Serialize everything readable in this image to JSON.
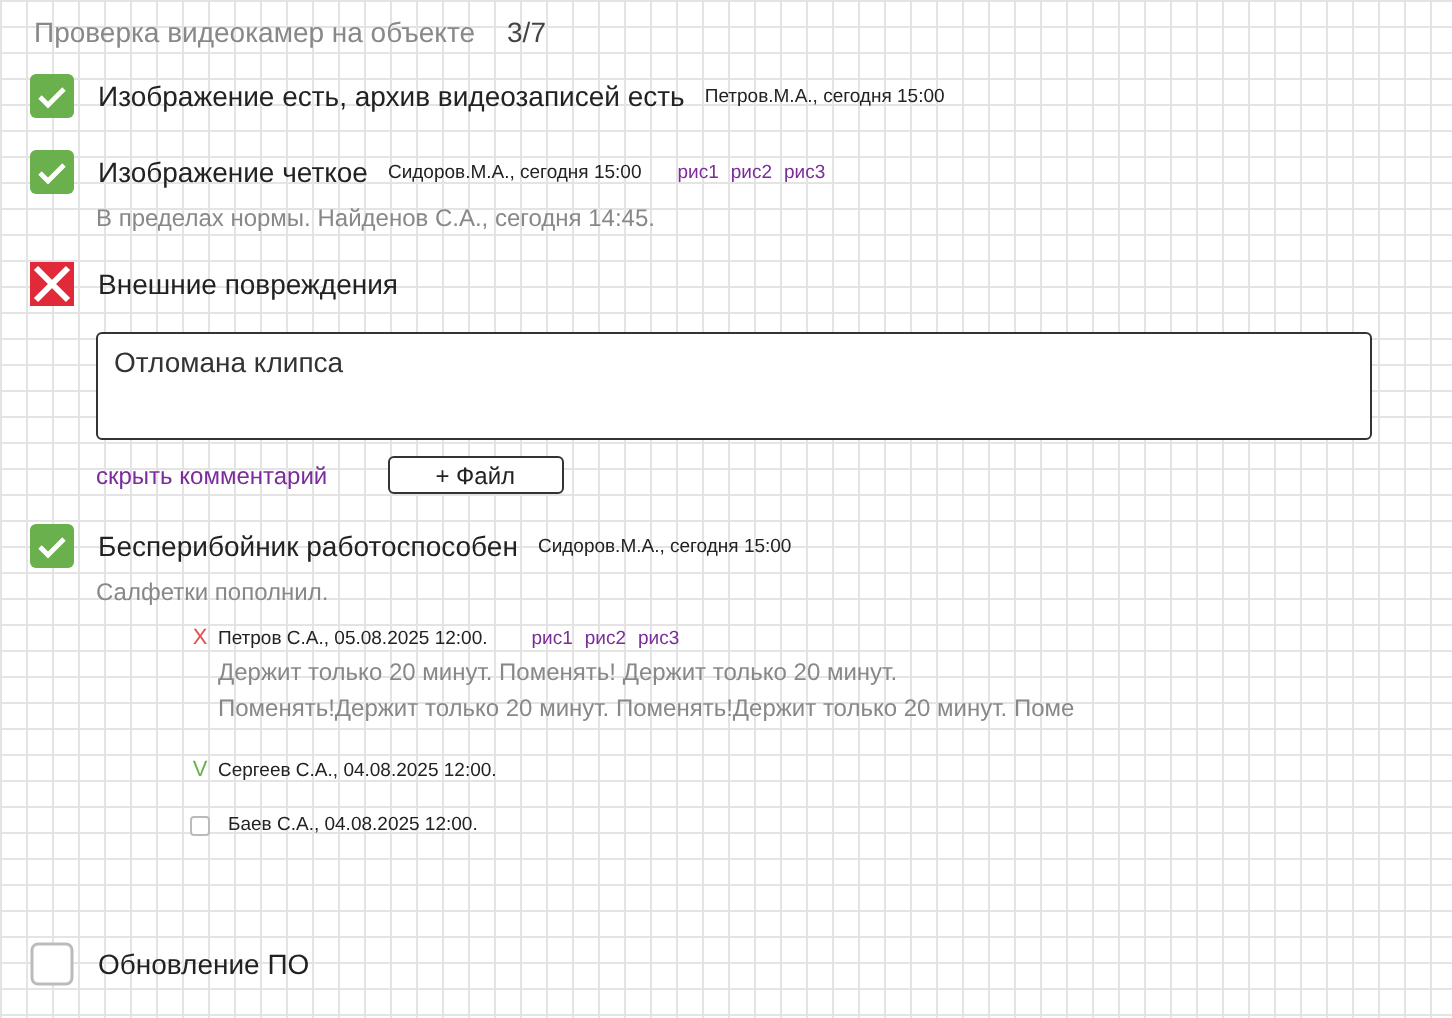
{
  "header": {
    "title": "Проверка видеокамер на объекте",
    "counter": "3/7"
  },
  "items": [
    {
      "checked": true,
      "failed": false,
      "label": "Изображение есть, архив видеозаписей есть",
      "meta": "Петров.М.А., сегодня 15:00"
    },
    {
      "checked": true,
      "failed": false,
      "label": "Изображение четкое",
      "meta": "Сидоров.М.А., сегодня 15:00",
      "links": [
        "рис1",
        "рис2",
        "рис3"
      ],
      "note": "В пределах нормы. Найденов С.А., сегодня 14:45."
    },
    {
      "checked": false,
      "failed": true,
      "label": "Внешние повреждения",
      "comment": {
        "value": "Отломана клипса"
      },
      "hide_link": "скрыть комментарий",
      "file_button": "+ Файл"
    },
    {
      "checked": true,
      "failed": false,
      "label": "Бесперибойник работоспособен",
      "meta": "Сидоров.М.А., сегодня 15:00",
      "note": "Салфетки пополнил.",
      "history": [
        {
          "kind": "rejected",
          "symbol": "X",
          "author": "Петров С.А., 05.08.2025 12:00.",
          "links": [
            "рис1",
            "рис2",
            "рис3"
          ],
          "lines": [
            "Держит только 20 минут. Поменять! Держит только 20 минут.",
            "Поменять!Держит только 20 минут. Поменять!Держит только 20 минут. Поме"
          ]
        },
        {
          "kind": "approved",
          "symbol": "V",
          "author": "Сергеев С.А., 04.08.2025 12:00."
        },
        {
          "kind": "pending",
          "author": "Баев С.А., 04.08.2025 12:00."
        }
      ]
    },
    {
      "checked": false,
      "failed": false,
      "label": "Обновление ПО"
    }
  ]
}
